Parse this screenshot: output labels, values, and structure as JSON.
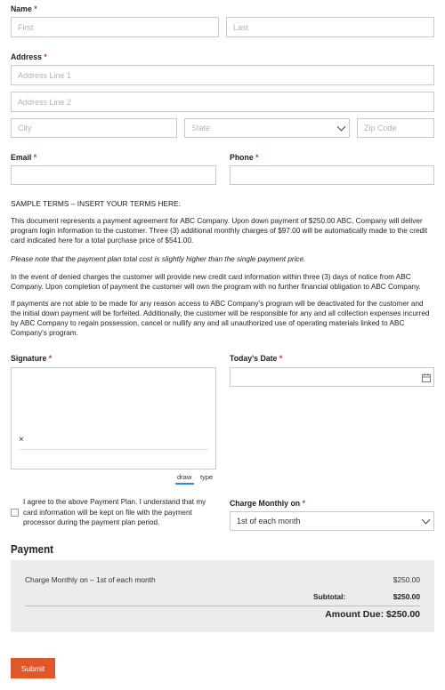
{
  "name": {
    "label": "Name",
    "required": "*",
    "first_placeholder": "First",
    "last_placeholder": "Last"
  },
  "address": {
    "label": "Address",
    "required": "*",
    "line1_placeholder": "Address Line 1",
    "line2_placeholder": "Address Line 2",
    "city_placeholder": "City",
    "state_placeholder": "State",
    "zip_placeholder": "Zip Code"
  },
  "email": {
    "label": "Email",
    "required": "*"
  },
  "phone": {
    "label": "Phone",
    "required": "*"
  },
  "terms": {
    "heading": "SAMPLE TERMS – INSERT YOUR TERMS HERE:",
    "p1": "This document represents a payment agreement for ABC Company. Upon down payment of $250.00 ABC, Company will deliver program login information to the customer. Three (3) additional monthly charges of $97.00 will be automatically made to the credit card indicated here for a total purchase price of $541.00.",
    "p2": "Please note that the payment plan total cost is slightly higher than the single payment price.",
    "p3": "In the event of denied charges the customer will provide new credit card information within three (3) days of notice from ABC Company. Upon completion of payment the customer will own the program with no further financial obligation to ABC Company.",
    "p4": "If payments are not able to be made for any reason access to ABC Company’s program will be deactivated for the customer and the initial down payment will be forfeited. Additionally, the customer will be responsible for any and all collection expenses incurred by ABC Company to regain possession, cancel or nullify any and all unauthorized use of operating materials linked to ABC Company’s program."
  },
  "signature": {
    "label": "Signature",
    "required": "*",
    "x_mark": "×",
    "tab_draw": "draw",
    "tab_type": "type"
  },
  "todays_date": {
    "label": "Today's Date",
    "required": "*"
  },
  "agreement": {
    "text": "I agree to the above Payment Plan. I understand that my card information will be kept on file with the payment processor during the payment plan period.",
    "checked": false
  },
  "charge_monthly": {
    "label": "Charge Monthly on",
    "required": "*",
    "selected": "1st of each month"
  },
  "payment": {
    "heading": "Payment",
    "line_item": "Charge Monthly on – 1st of each month",
    "line_amount": "$250.00",
    "subtotal_label": "Subtotal:",
    "subtotal_amount": "$250.00",
    "amount_due": "Amount Due: $250.00"
  },
  "submit": {
    "label": "Submit",
    "color": "#e0572a"
  }
}
